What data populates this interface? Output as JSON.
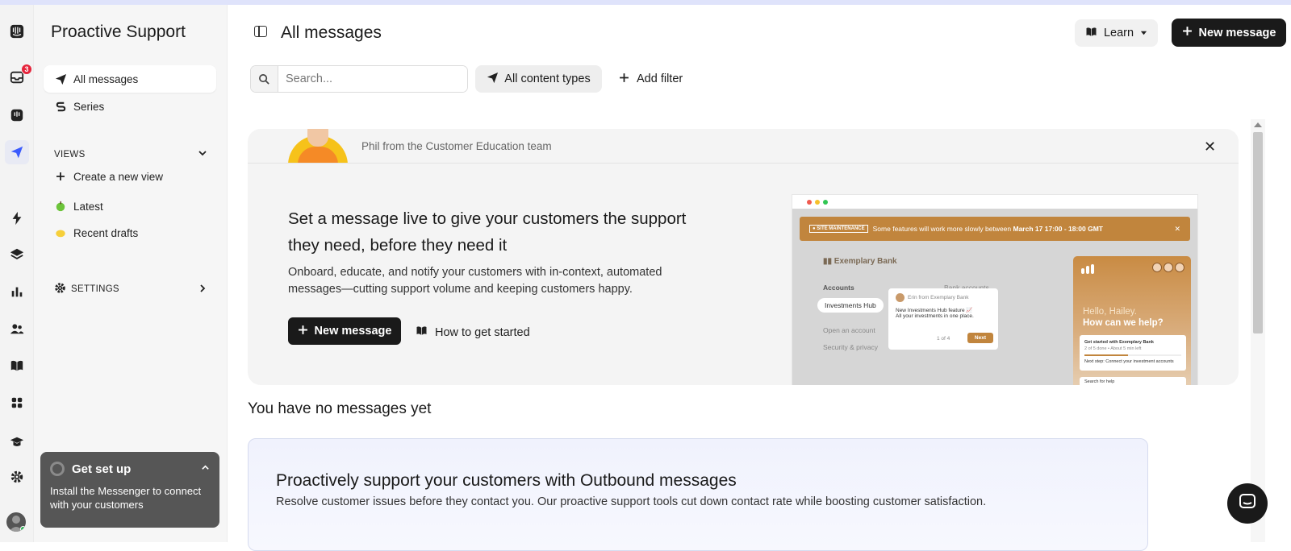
{
  "rail": {
    "inbox_badge": "3"
  },
  "sidebar": {
    "title": "Proactive Support",
    "items": [
      {
        "label": "All messages"
      },
      {
        "label": "Series"
      }
    ],
    "views_label": "VIEWS",
    "create_view": "Create a new view",
    "views": [
      {
        "label": "Latest"
      },
      {
        "label": "Recent drafts"
      }
    ],
    "settings_label": "SETTINGS",
    "setup": {
      "title": "Get set up",
      "text": "Install the Messenger to connect with your customers"
    }
  },
  "header": {
    "title": "All messages",
    "learn_label": "Learn",
    "new_message_label": "New message"
  },
  "filters": {
    "search_placeholder": "Search...",
    "content_types_label": "All content types",
    "add_filter_label": "Add filter"
  },
  "promo": {
    "from": "Phil from the Customer Education team",
    "heading": "Set a message live to give your customers the support they need, before they need it",
    "body": "Onboard, educate, and notify your customers with in-context, automated messages—cutting support volume and keeping customers happy.",
    "new_message_label": "New message",
    "howto_label": "How to get started",
    "mock": {
      "banner_tag": "● SITE MAINTENANCE",
      "banner_text": "Some features will work more slowly between",
      "banner_time": "March 17 17:00 - 18:00 GMT",
      "bank_name": "Exemplary Bank",
      "accounts": "Accounts",
      "bank_accounts": "Bank accounts",
      "investments": "Investments Hub",
      "open_account": "Open an account",
      "security": "Security & privacy",
      "pop_from": "Erin from Exemplary Bank",
      "pop_line1": "New Investments Hub feature 📈",
      "pop_line2": "All your investments in one place.",
      "pop_page": "1 of 4",
      "pop_next": "Next",
      "hello": "Hello, Hailey.",
      "help": "How can we help?",
      "card_title": "Get started with Exemplary Bank",
      "card_sub": "2 of 5 done • About 5 min left",
      "card_next": "Next step: Connect your investment accounts",
      "search_help": "Search for help"
    }
  },
  "empty": {
    "title": "You have no messages yet"
  },
  "outbound": {
    "title": "Proactively support your customers with Outbound messages",
    "desc": "Resolve customer issues before they contact you. Our proactive support tools cut down contact rate while boosting customer satisfaction."
  }
}
